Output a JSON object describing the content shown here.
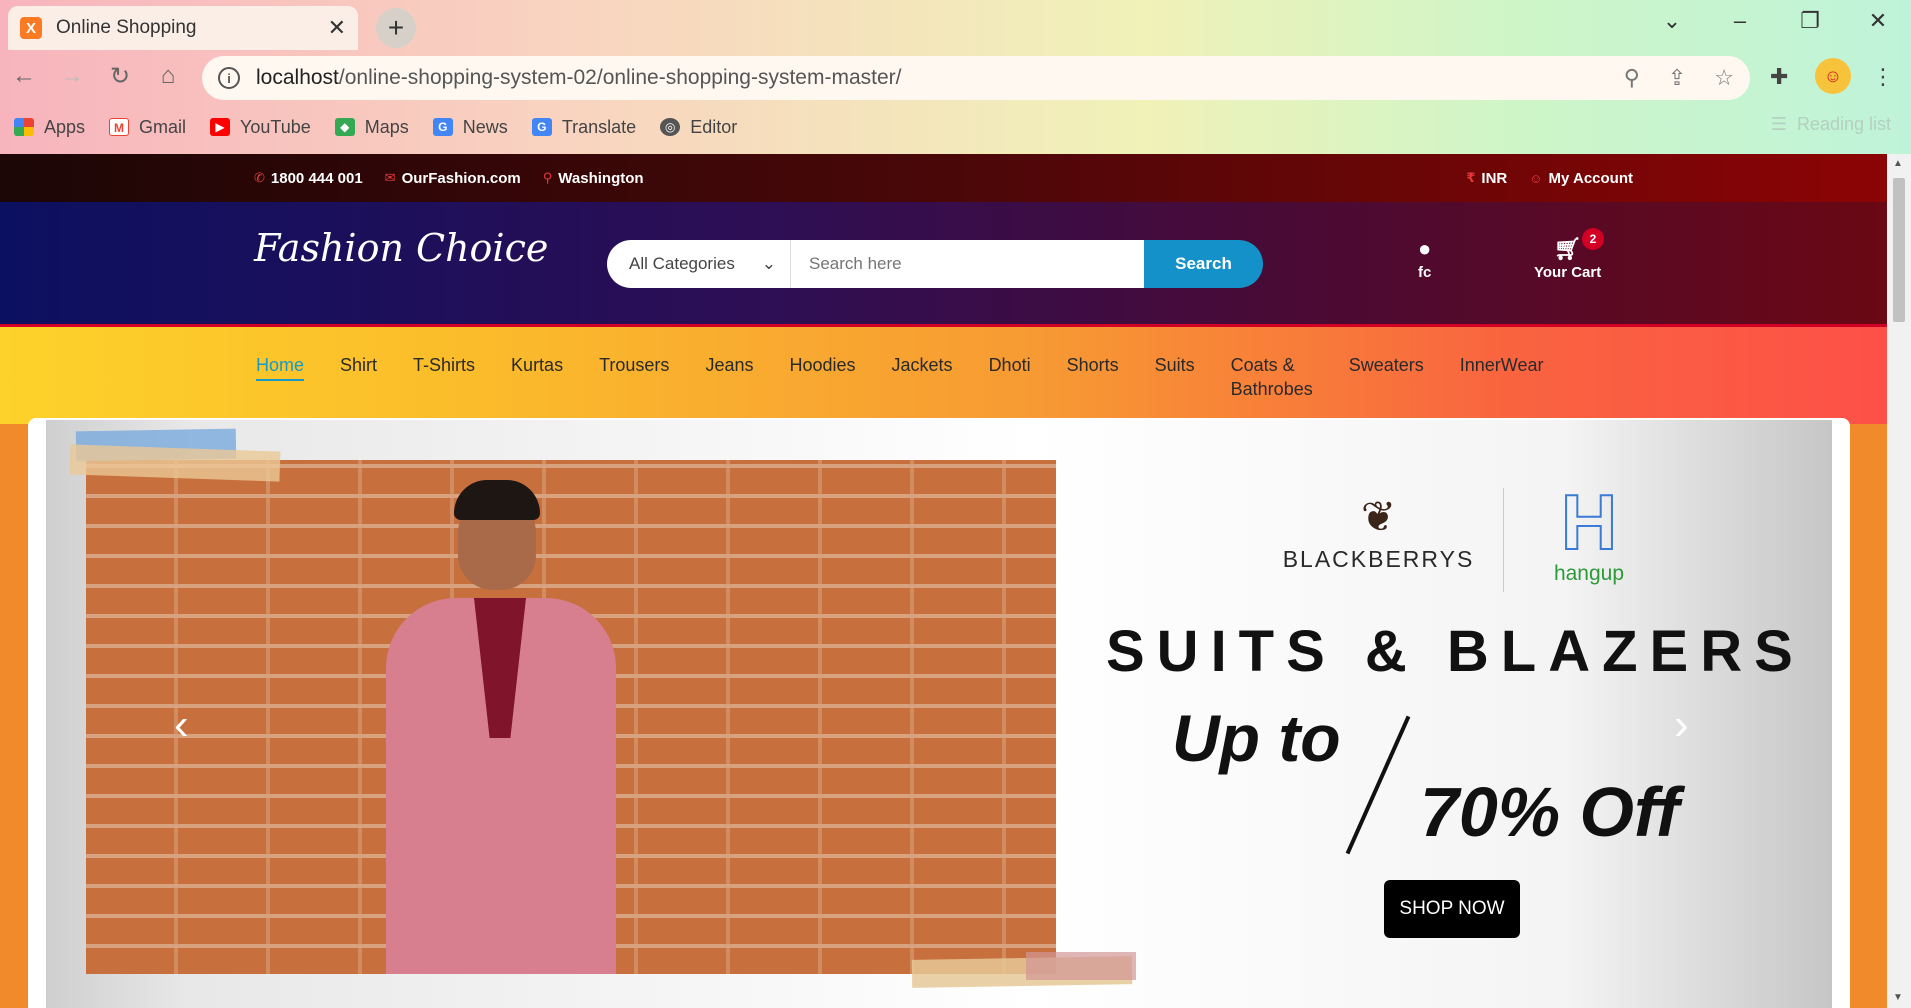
{
  "browser": {
    "tab_title": "Online Shopping",
    "favicon_label": "X",
    "url_host": "localhost",
    "url_path": "/online-shopping-system-02/online-shopping-system-master/",
    "bookmarks": [
      "Apps",
      "Gmail",
      "YouTube",
      "Maps",
      "News",
      "Translate",
      "Editor"
    ],
    "reading_list": "Reading list"
  },
  "topbar": {
    "phone": "1800 444 001",
    "email": "OurFashion.com",
    "location": "Washington",
    "currency": "INR",
    "account": "My Account"
  },
  "header": {
    "logo": "Fashion Choice",
    "category_selected": "All Categories",
    "search_placeholder": "Search here",
    "search_button": "Search",
    "github_label": "fc",
    "cart_label": "Your Cart",
    "cart_count": "2"
  },
  "nav": {
    "items": [
      "Home",
      "Shirt",
      "T-Shirts",
      "Kurtas",
      "Trousers",
      "Jeans",
      "Hoodies",
      "Jackets",
      "Dhoti",
      "Shorts",
      "Suits",
      "Coats &",
      "Bathrobes",
      "Sweaters",
      "InnerWear"
    ]
  },
  "banner": {
    "brand1": "BLACKBERRYS",
    "brand2": "hangup",
    "brand2_mark": "H",
    "headline": "SUITS & BLAZERS",
    "upto": "Up to",
    "offer": "70% Off",
    "cta": "SHOP NOW"
  },
  "colors": {
    "accent": "#149bc9",
    "badge": "#d10024",
    "search_button": "#1391c8"
  }
}
